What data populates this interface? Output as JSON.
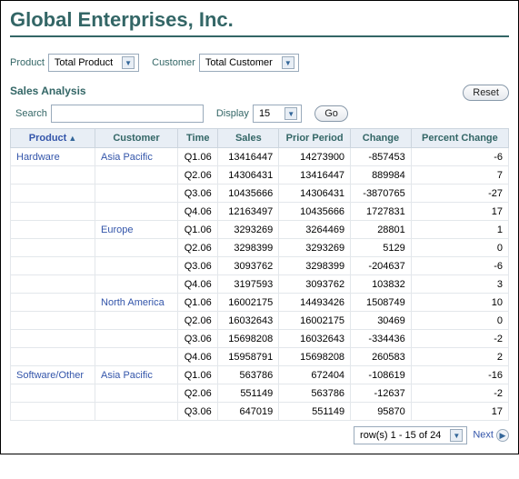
{
  "title": "Global Enterprises, Inc.",
  "filters": {
    "product_label": "Product",
    "product_value": "Total Product",
    "customer_label": "Customer",
    "customer_value": "Total Customer"
  },
  "section_title": "Sales Analysis",
  "reset_label": "Reset",
  "search_label": "Search",
  "search_value": "",
  "display_label": "Display",
  "display_value": "15",
  "go_label": "Go",
  "columns": {
    "product": "Product",
    "customer": "Customer",
    "time": "Time",
    "sales": "Sales",
    "prior": "Prior Period",
    "change": "Change",
    "pct": "Percent Change"
  },
  "sort_indicator": "▲",
  "rows": [
    {
      "product": "Hardware",
      "customer": "Asia Pacific",
      "time": "Q1.06",
      "sales": "13416447",
      "prior": "14273900",
      "change": "-857453",
      "pct": "-6"
    },
    {
      "product": "",
      "customer": "",
      "time": "Q2.06",
      "sales": "14306431",
      "prior": "13416447",
      "change": "889984",
      "pct": "7"
    },
    {
      "product": "",
      "customer": "",
      "time": "Q3.06",
      "sales": "10435666",
      "prior": "14306431",
      "change": "-3870765",
      "pct": "-27"
    },
    {
      "product": "",
      "customer": "",
      "time": "Q4.06",
      "sales": "12163497",
      "prior": "10435666",
      "change": "1727831",
      "pct": "17"
    },
    {
      "product": "",
      "customer": "Europe",
      "time": "Q1.06",
      "sales": "3293269",
      "prior": "3264469",
      "change": "28801",
      "pct": "1"
    },
    {
      "product": "",
      "customer": "",
      "time": "Q2.06",
      "sales": "3298399",
      "prior": "3293269",
      "change": "5129",
      "pct": "0"
    },
    {
      "product": "",
      "customer": "",
      "time": "Q3.06",
      "sales": "3093762",
      "prior": "3298399",
      "change": "-204637",
      "pct": "-6"
    },
    {
      "product": "",
      "customer": "",
      "time": "Q4.06",
      "sales": "3197593",
      "prior": "3093762",
      "change": "103832",
      "pct": "3"
    },
    {
      "product": "",
      "customer": "North America",
      "time": "Q1.06",
      "sales": "16002175",
      "prior": "14493426",
      "change": "1508749",
      "pct": "10"
    },
    {
      "product": "",
      "customer": "",
      "time": "Q2.06",
      "sales": "16032643",
      "prior": "16002175",
      "change": "30469",
      "pct": "0"
    },
    {
      "product": "",
      "customer": "",
      "time": "Q3.06",
      "sales": "15698208",
      "prior": "16032643",
      "change": "-334436",
      "pct": "-2"
    },
    {
      "product": "",
      "customer": "",
      "time": "Q4.06",
      "sales": "15958791",
      "prior": "15698208",
      "change": "260583",
      "pct": "2"
    },
    {
      "product": "Software/Other",
      "customer": "Asia Pacific",
      "time": "Q1.06",
      "sales": "563786",
      "prior": "672404",
      "change": "-108619",
      "pct": "-16"
    },
    {
      "product": "",
      "customer": "",
      "time": "Q2.06",
      "sales": "551149",
      "prior": "563786",
      "change": "-12637",
      "pct": "-2"
    },
    {
      "product": "",
      "customer": "",
      "time": "Q3.06",
      "sales": "647019",
      "prior": "551149",
      "change": "95870",
      "pct": "17"
    }
  ],
  "pager": {
    "range": "row(s) 1 - 15 of 24",
    "next_label": "Next"
  }
}
